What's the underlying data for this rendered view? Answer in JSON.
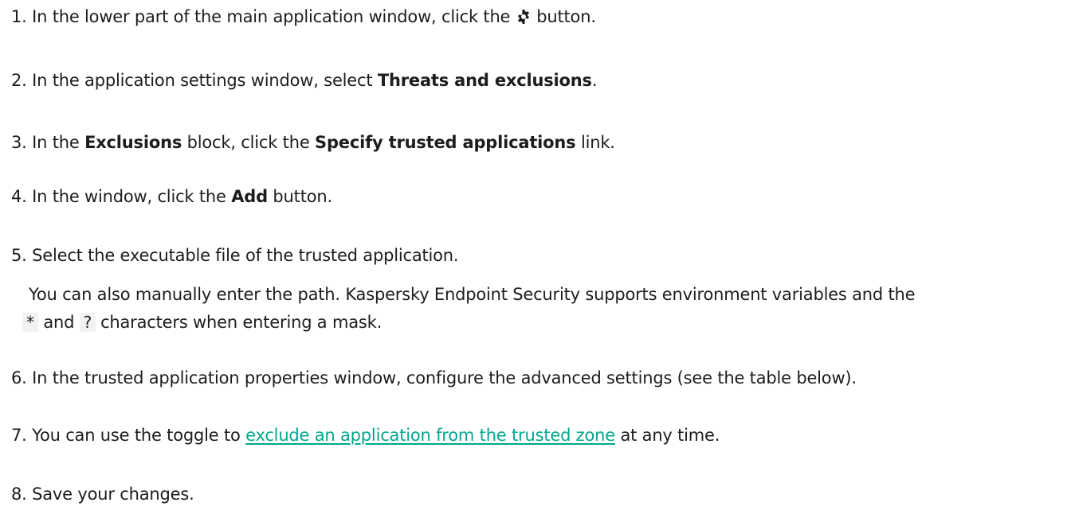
{
  "steps": [
    {
      "num": "1.",
      "pre": "In the lower part of the main application window, click the",
      "post": "button.",
      "icon": "gear-icon"
    },
    {
      "num": "2.",
      "pre": "In the application settings window, select",
      "bold": "Threats and exclusions",
      "post": "."
    },
    {
      "num": "3.",
      "pre": "In the",
      "bold1": "Exclusions",
      "mid": "block, click the",
      "bold2": "Specify trusted applications",
      "post": "link."
    },
    {
      "num": "4.",
      "pre": "In the window, click the",
      "bold": "Add",
      "post": "button."
    },
    {
      "num": "5.",
      "text": "Select the executable file of the trusted application."
    },
    {
      "num": "6.",
      "text": "In the trusted application properties window, configure the advanced settings (see the table below)."
    },
    {
      "num": "7.",
      "pre": "You can use the toggle to",
      "link": "exclude an application from the trusted zone",
      "post": "at any time."
    },
    {
      "num": "8.",
      "text": "Save your changes."
    }
  ],
  "note": {
    "line1": "You can also manually enter the path. Kaspersky Endpoint Security supports environment variables and the",
    "code1": "*",
    "and": "and",
    "code2": "?",
    "line2_rest": "characters when entering a mask."
  }
}
